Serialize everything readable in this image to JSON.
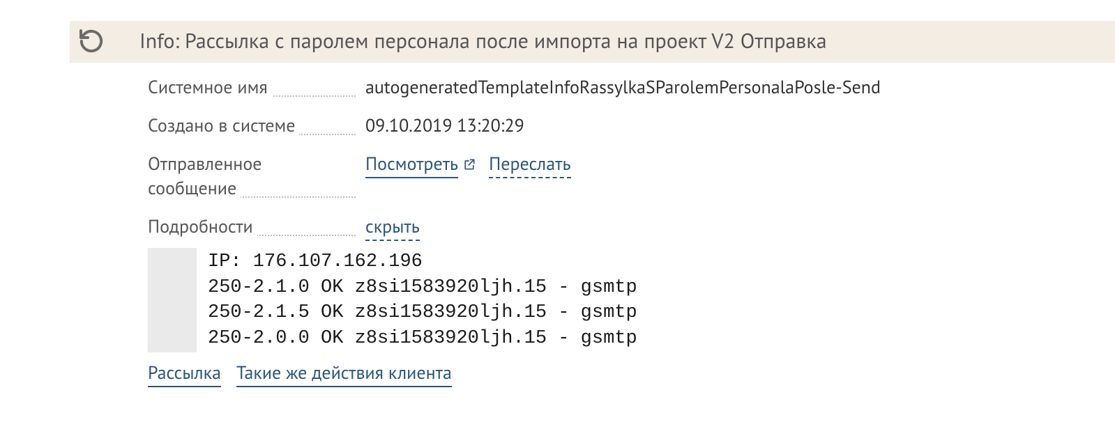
{
  "header": {
    "title": "Info: Рассылка с паролем персонала после импорта на проект V2 Отправка"
  },
  "fields": {
    "system_name": {
      "label": "Системное имя",
      "value": "autogeneratedTemplateInfoRassylkaSParolemPersonalaPosle-Send"
    },
    "created": {
      "label": "Создано в системе",
      "value": "09.10.2019 13:20:29"
    },
    "sent_message": {
      "label": "Отправленное сообщение",
      "view": "Посмотреть",
      "forward": "Переслать"
    },
    "details": {
      "label": "Подробности",
      "toggle": "скрыть"
    }
  },
  "log": "IP: 176.107.162.196\n250-2.1.0 OK z8si1583920ljh.15 - gsmtp\n250-2.1.5 OK z8si1583920ljh.15 - gsmtp\n250-2.0.0 OK z8si1583920ljh.15 - gsmtp",
  "footer": {
    "mailing": "Рассылка",
    "same_actions": "Такие же действия клиента"
  }
}
